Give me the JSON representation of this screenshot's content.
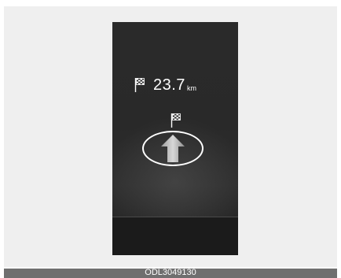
{
  "navigation": {
    "distance_value": "23.7",
    "distance_unit": "km",
    "distance_icon": "checkered-flag-icon",
    "destination_icon": "checkered-flag-icon",
    "direction_icon": "straight-arrow-icon",
    "direction": "straight"
  },
  "caption": {
    "code": "ODL3049130"
  },
  "colors": {
    "display_background": "#2a2a2a",
    "text": "#ffffff",
    "arrow_fill": "#c8c8c8",
    "footer_band": "#6f6f6f"
  }
}
